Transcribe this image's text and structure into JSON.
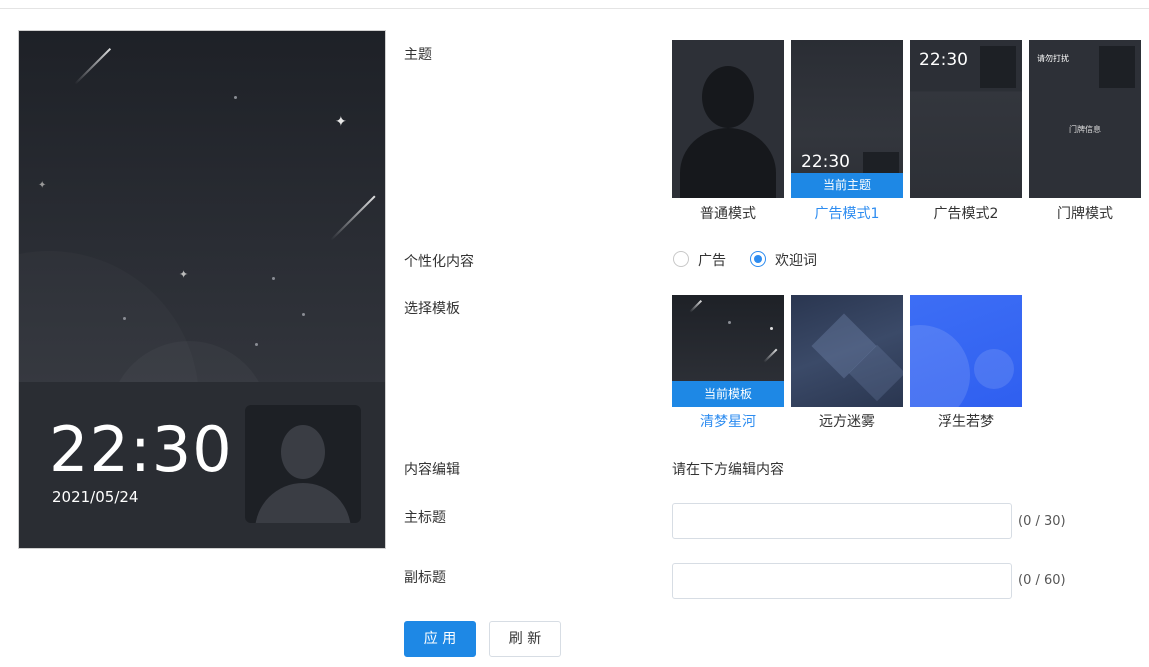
{
  "preview": {
    "time": "22:30",
    "date": "2021/05/24"
  },
  "theme": {
    "label": "主题",
    "options": [
      {
        "name": "普通模式",
        "active": false
      },
      {
        "name": "广告模式1",
        "active": true,
        "badge": "当前主题",
        "preview_time": "22:30"
      },
      {
        "name": "广告模式2",
        "active": false,
        "preview_time": "22:30"
      },
      {
        "name": "门牌模式",
        "active": false,
        "preview_title": "请勿打扰",
        "preview_center": "门牌信息"
      }
    ]
  },
  "personalized": {
    "label": "个性化内容",
    "options": [
      {
        "name": "广告",
        "checked": false
      },
      {
        "name": "欢迎词",
        "checked": true
      }
    ]
  },
  "template": {
    "label": "选择模板",
    "options": [
      {
        "name": "清梦星河",
        "active": true,
        "badge": "当前模板"
      },
      {
        "name": "远方迷雾",
        "active": false
      },
      {
        "name": "浮生若梦",
        "active": false
      }
    ]
  },
  "content_edit": {
    "label": "内容编辑",
    "hint": "请在下方编辑内容"
  },
  "main_title": {
    "label": "主标题",
    "value": "",
    "counter": "(0 / 30)"
  },
  "sub_title": {
    "label": "副标题",
    "value": "",
    "counter": "(0 / 60)"
  },
  "buttons": {
    "apply": "应 用",
    "refresh": "刷 新"
  },
  "colors": {
    "accent": "#1e88e5",
    "link": "#2d8cf0"
  }
}
